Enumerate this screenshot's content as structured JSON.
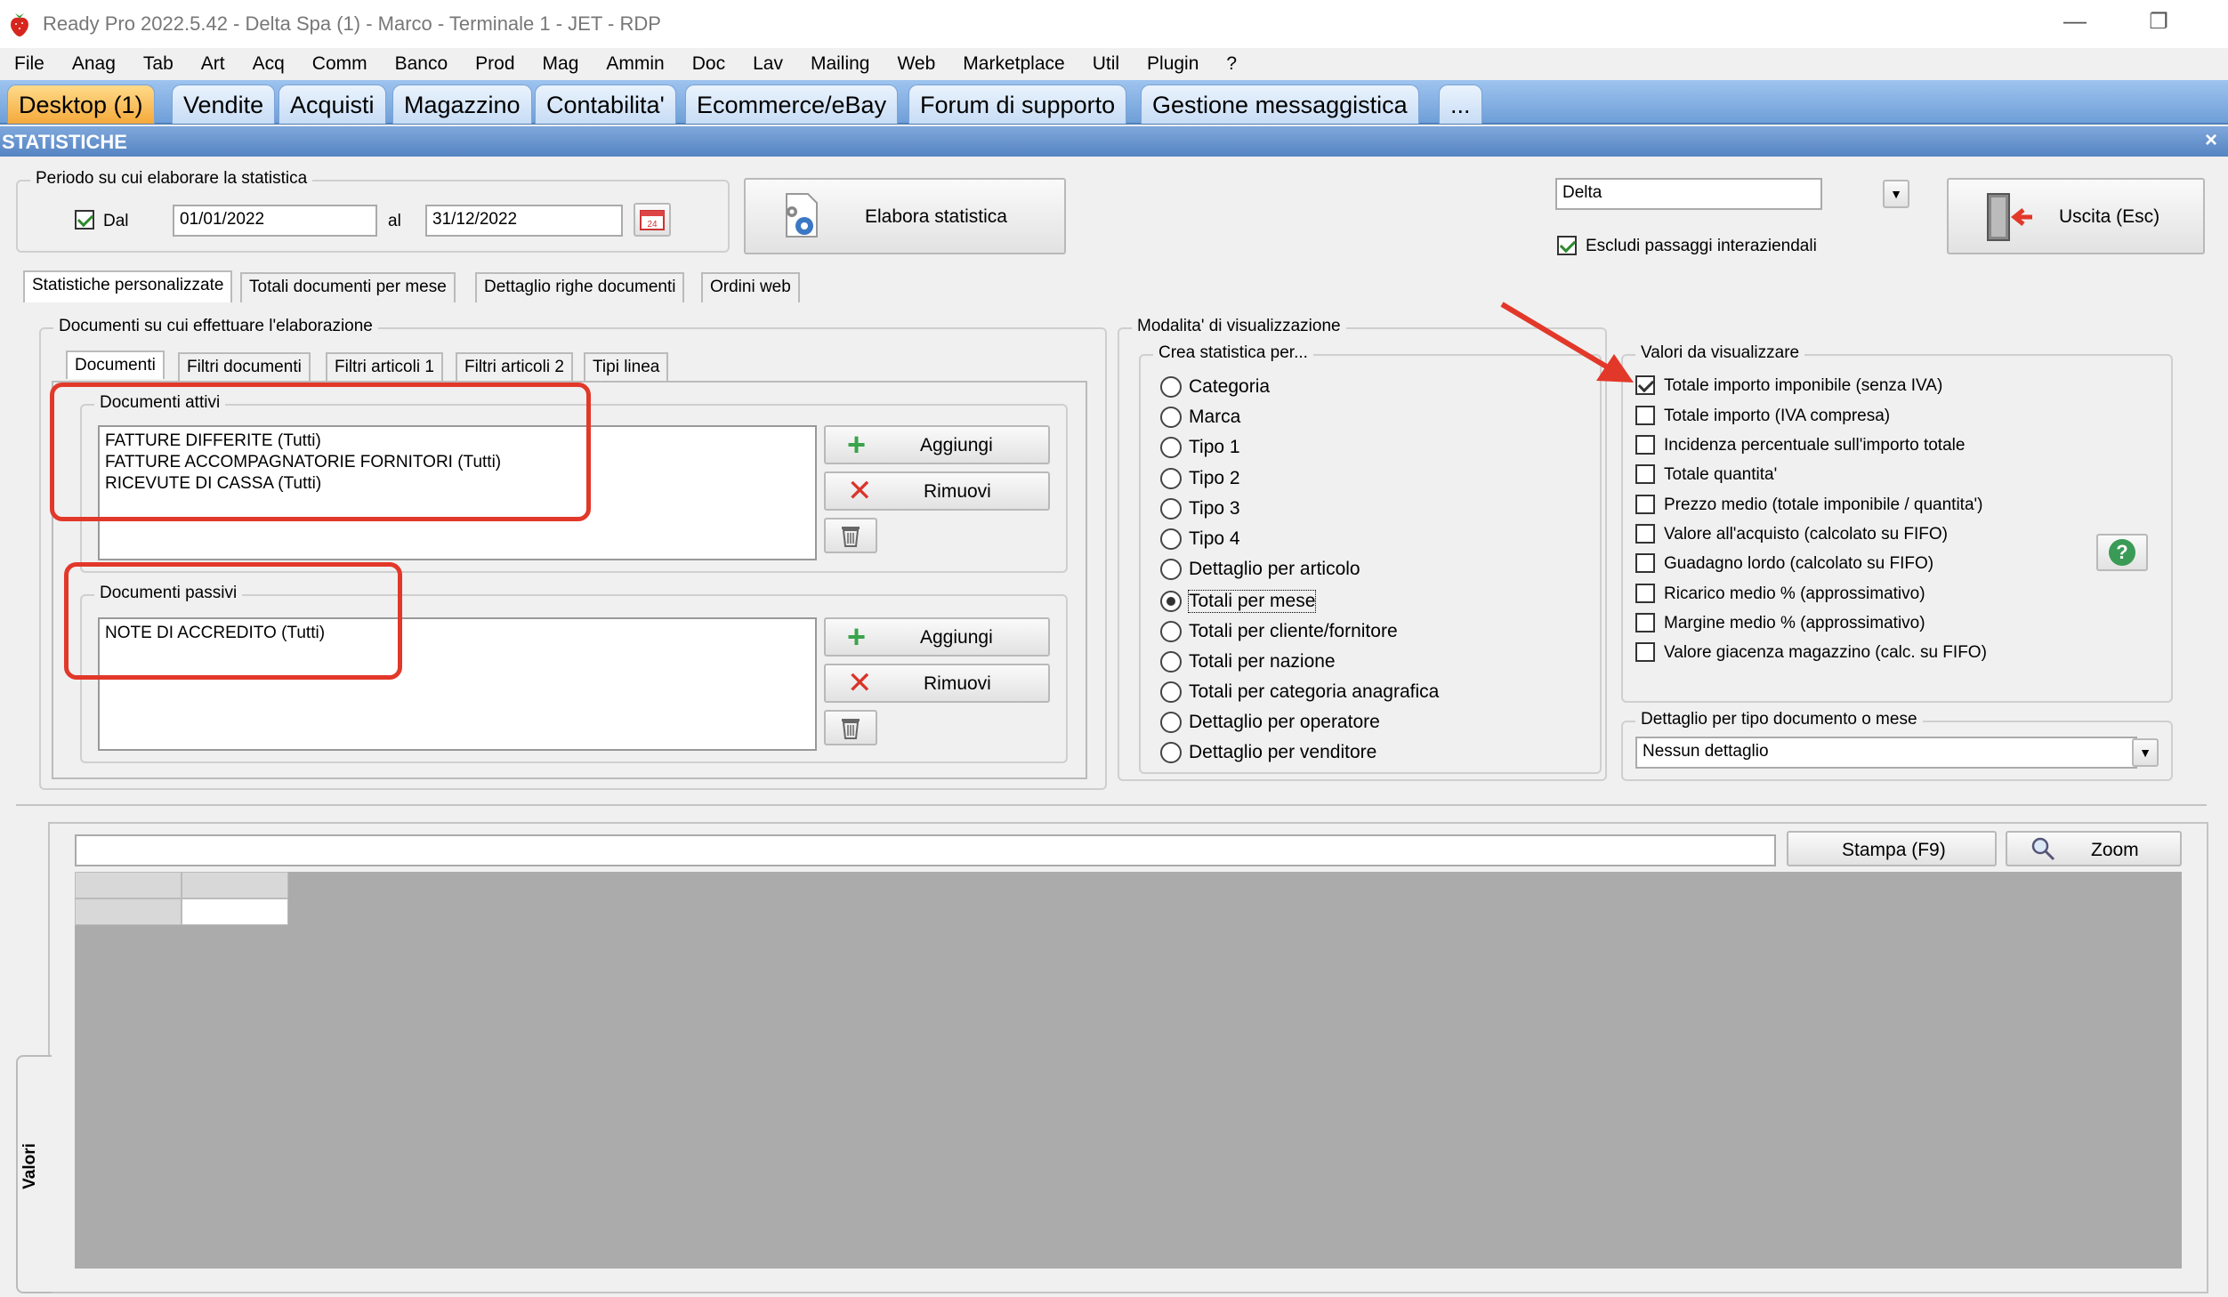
{
  "window": {
    "title": "Ready Pro 2022.5.42 - Delta Spa (1) - Marco - Terminale 1 - JET - RDP",
    "minimize_glyph": "—",
    "restore_glyph": "❐"
  },
  "menu": [
    "File",
    "Anag",
    "Tab",
    "Art",
    "Acq",
    "Comm",
    "Banco",
    "Prod",
    "Mag",
    "Ammin",
    "Doc",
    "Lav",
    "Mailing",
    "Web",
    "Marketplace",
    "Util",
    "Plugin",
    "?"
  ],
  "desktop_tabs": [
    "Desktop (1)",
    "Vendite",
    "Acquisti",
    "Magazzino",
    "Contabilita'",
    "Ecommerce/eBay",
    "Forum di supporto",
    "Gestione messaggistica",
    "..."
  ],
  "section": {
    "title": "STATISTICHE",
    "close": "×"
  },
  "period": {
    "group_title": "Periodo su cui elaborare la statistica",
    "from_label": "Dal",
    "from_checked": true,
    "from_value": "01/01/2022",
    "to_label": "al",
    "to_value": "31/12/2022",
    "calendar_text": "24"
  },
  "elabora_button": "Elabora statistica",
  "company_select": "Delta",
  "exclude_checkbox": {
    "label": "Escludi passaggi interaziendali",
    "checked": true
  },
  "exit_button": "Uscita (Esc)",
  "stat_tabs": [
    "Statistiche personalizzate",
    "Totali documenti per mese",
    "Dettaglio righe documenti",
    "Ordini web"
  ],
  "documents": {
    "group_title": "Documenti su cui effettuare l'elaborazione",
    "tabs": [
      "Documenti",
      "Filtri documenti",
      "Filtri articoli 1",
      "Filtri articoli 2",
      "Tipi linea"
    ],
    "active": {
      "title": "Documenti attivi",
      "items": [
        "FATTURE DIFFERITE (Tutti)",
        "FATTURE ACCOMPAGNATORIE FORNITORI (Tutti)",
        "RICEVUTE DI CASSA (Tutti)"
      ]
    },
    "passive": {
      "title": "Documenti passivi",
      "items": [
        "NOTE DI ACCREDITO (Tutti)"
      ]
    },
    "add_label": "Aggiungi",
    "remove_label": "Rimuovi"
  },
  "display_mode": {
    "group_title": "Modalita' di visualizzazione",
    "subgroup_title": "Crea statistica per...",
    "options": [
      "Categoria",
      "Marca",
      "Tipo 1",
      "Tipo 2",
      "Tipo 3",
      "Tipo 4",
      "Dettaglio per articolo",
      "Totali per mese",
      "Totali per cliente/fornitore",
      "Totali per nazione",
      "Totali per categoria anagrafica",
      "Dettaglio per operatore",
      "Dettaglio per venditore"
    ],
    "selected": "Totali per mese"
  },
  "values": {
    "group_title": "Valori da visualizzare",
    "options": [
      {
        "label": "Totale importo imponibile (senza IVA)",
        "checked": true
      },
      {
        "label": "Totale importo (IVA compresa)",
        "checked": false
      },
      {
        "label": "Incidenza percentuale sull'importo totale",
        "checked": false
      },
      {
        "label": "Totale quantita'",
        "checked": false
      },
      {
        "label": "Prezzo medio (totale imponibile / quantita')",
        "checked": false
      },
      {
        "label": "Valore all'acquisto (calcolato su FIFO)",
        "checked": false
      },
      {
        "label": "Guadagno lordo (calcolato su FIFO)",
        "checked": false
      },
      {
        "label": "Ricarico medio % (approssimativo)",
        "checked": false
      },
      {
        "label": "Margine medio % (approssimativo)",
        "checked": false
      },
      {
        "label": "Valore giacenza magazzino (calc. su FIFO)",
        "checked": false
      }
    ],
    "help_glyph": "?"
  },
  "detail": {
    "group_title": "Dettaglio per tipo documento o mese",
    "value": "Nessun dettaglio"
  },
  "results": {
    "print_button": "Stampa (F9)",
    "zoom_button": "Zoom",
    "side_tab": "Valori"
  },
  "colors": {
    "accent_tab": "#f4a93b",
    "tab_bar": "#6f9fd8",
    "highlight_red": "#e2382a",
    "grid_bg": "#ababab"
  }
}
